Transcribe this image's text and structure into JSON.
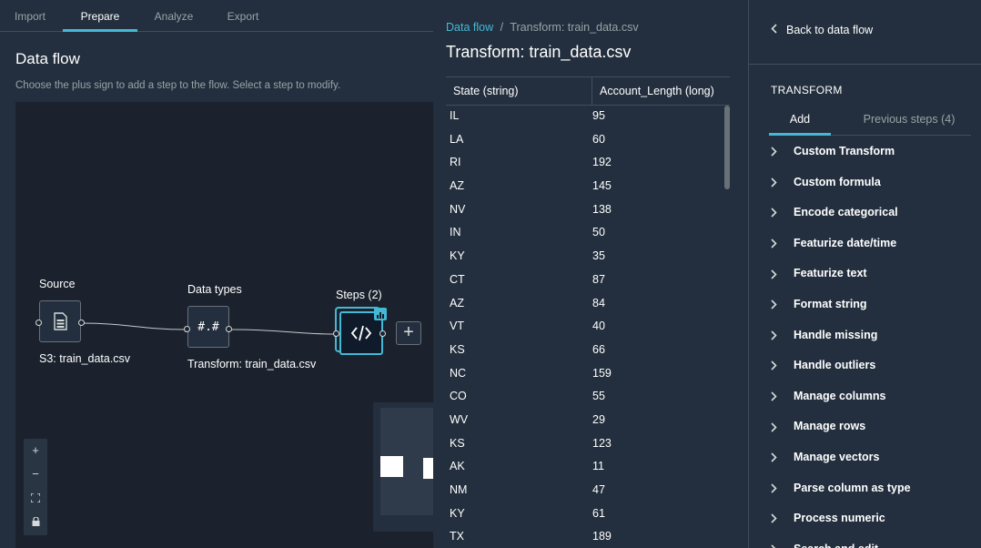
{
  "nav_tabs": [
    "Import",
    "Prepare",
    "Analyze",
    "Export"
  ],
  "active_tab": "Prepare",
  "data_flow": {
    "title": "Data flow",
    "description": "Choose the plus sign to add a step to the flow. Select a step to modify.",
    "nodes": {
      "source": {
        "title": "Source",
        "label": "S3: train_data.csv",
        "icon": "file-table-icon"
      },
      "data_types": {
        "title": "Data types",
        "label": "Transform: train_data.csv",
        "icon_text": "#.#"
      },
      "steps": {
        "title": "Steps (2)",
        "icon": "code-icon"
      }
    },
    "add_step": "+",
    "zoom_controls": [
      "+",
      "−",
      "⛶",
      "🔒"
    ]
  },
  "transform_view": {
    "breadcrumb": {
      "link": "Data flow",
      "separator": "/",
      "current": "Transform: train_data.csv"
    },
    "title": "Transform: train_data.csv",
    "columns": [
      "State (string)",
      "Account_Length (long)"
    ],
    "rows": [
      [
        "IL",
        "95"
      ],
      [
        "LA",
        "60"
      ],
      [
        "RI",
        "192"
      ],
      [
        "AZ",
        "145"
      ],
      [
        "NV",
        "138"
      ],
      [
        "IN",
        "50"
      ],
      [
        "KY",
        "35"
      ],
      [
        "CT",
        "87"
      ],
      [
        "AZ",
        "84"
      ],
      [
        "VT",
        "40"
      ],
      [
        "KS",
        "66"
      ],
      [
        "NC",
        "159"
      ],
      [
        "CO",
        "55"
      ],
      [
        "WV",
        "29"
      ],
      [
        "KS",
        "123"
      ],
      [
        "AK",
        "11"
      ],
      [
        "NM",
        "47"
      ],
      [
        "KY",
        "61"
      ],
      [
        "TX",
        "189"
      ]
    ]
  },
  "transform_panel": {
    "back_label": "Back to data flow",
    "header": "TRANSFORM",
    "tabs": [
      "Add",
      "Previous steps (4)"
    ],
    "active_tab": "Add",
    "items": [
      "Custom Transform",
      "Custom formula",
      "Encode categorical",
      "Featurize date/time",
      "Featurize text",
      "Format string",
      "Handle missing",
      "Handle outliers",
      "Manage columns",
      "Manage rows",
      "Manage vectors",
      "Parse column as type",
      "Process numeric",
      "Search and edit"
    ]
  },
  "colors": {
    "accent": "#44b9d6",
    "background": "#232f3e",
    "canvas": "#1b222d"
  }
}
